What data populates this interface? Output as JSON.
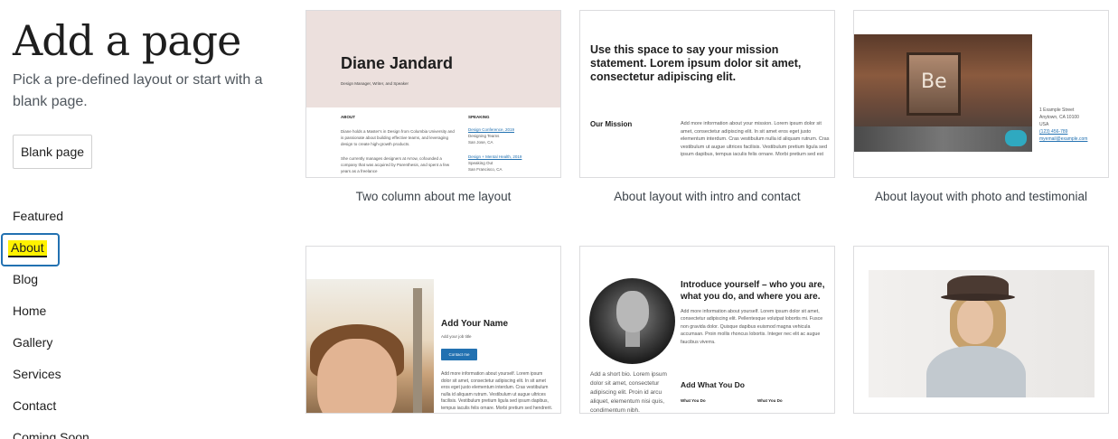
{
  "sidebar": {
    "title": "Add a page",
    "subtitle": "Pick a pre-defined layout or start with a blank page.",
    "blank_button": "Blank page",
    "categories": [
      {
        "label": "Featured",
        "active": false
      },
      {
        "label": "About",
        "active": true
      },
      {
        "label": "Blog",
        "active": false
      },
      {
        "label": "Home",
        "active": false
      },
      {
        "label": "Gallery",
        "active": false
      },
      {
        "label": "Services",
        "active": false
      },
      {
        "label": "Contact",
        "active": false
      },
      {
        "label": "Coming Soon",
        "active": false
      }
    ]
  },
  "layouts": [
    {
      "label": "Two column about me layout",
      "preview": {
        "name": "Diane Jandard",
        "role": "Design Manager, Writer, and Speaker",
        "about_heading": "ABOUT",
        "about_p1": "Diane holds a Master's in Design from Columbia University and is passionate about building effective teams, and leveraging design to create high-growth products.",
        "about_p2": "She currently manages designers at Arrow, cofounded a company that was acquired by Parenthesis, and spent a few years as a freelance",
        "speaking_heading": "SPEAKING",
        "talk1_link": "Design Conference, 2019",
        "talk1_title": "Designing Teams",
        "talk1_place": "San Jose, CA",
        "talk2_link": "Design + Mental Health, 2019",
        "talk2_title": "Speaking Out",
        "talk2_place": "San Francisco, CA"
      }
    },
    {
      "label": "About layout with intro and contact",
      "preview": {
        "mission": "Use this space to say your mission statement. Lorem ipsum dolor sit amet, consectetur adipiscing elit.",
        "our_mission": "Our Mission",
        "body": "Add more information about your mission. Lorem ipsum dolor sit amet, consectetur adipiscing elit. In sit amet eros eget justo elementum interdum. Cras vestibulum nulla id aliquam rutrum. Cras vestibulum ut augue ultrices facilisis. Vestibulum pretium ligula sed ipsum dapibus, tempus iaculis felis ornare. Morbi pretium sed est"
      }
    },
    {
      "label": "About layout with photo and testimonial",
      "preview": {
        "sign": "Be",
        "address1": "1 Example Street",
        "address2": "Anytown, CA 10100",
        "address3": "USA",
        "phone": "(123) 456-789",
        "email": "myemail@example.com"
      }
    },
    {
      "label": "",
      "preview": {
        "title": "Add Your Name",
        "job_title": "Add your job title",
        "button": "Contact me",
        "body": "Add more information about yourself. Lorem ipsum dolor sit amet, consectetur adipiscing elit. In sit amet eros eget justo elementum interdum. Cras vestibulum nulla id aliquam rutrum. Vestibulum ut augue ultrices facilisis. Vestibulum pretium ligula sed ipsum dapibus, tempus iaculis felis ornare. Morbi pretium sed hendrerit."
      }
    },
    {
      "label": "",
      "preview": {
        "title": "Introduce yourself – who you are, what you do, and where you are.",
        "body": "Add more information about yourself. Lorem ipsum dolor sit amet, consectetur adipiscing elit. Pellentesque volutpat lobortis mi. Fusce non gravida dolor. Quisque dapibus euismod magna vehicula accumsan. Proin mollis rhoncus lobortis. Integer nec elit ac augue faucibus viverra.",
        "short_bio": "Add a short bio. Lorem ipsum dolor sit amet, consectetur adipiscing elit. Proin id arcu aliquet, elementum nisi quis, condimentum nibh.",
        "add_what": "Add What You Do",
        "what1": "What You Do",
        "what2": "What You Do"
      }
    },
    {
      "label": "",
      "preview": {}
    }
  ],
  "colors": {
    "focus_ring": "#2271b1",
    "highlight": "#fff200",
    "accent_button": "#2271b1",
    "card_border": "#dcdcde"
  }
}
